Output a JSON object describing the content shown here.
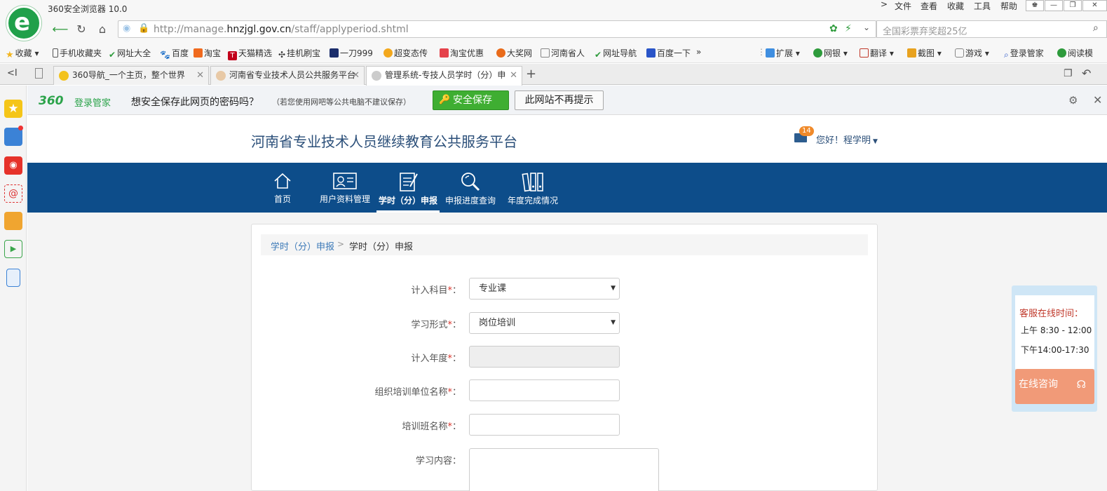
{
  "browser": {
    "title": "360安全浏览器 10.0",
    "menu": [
      "文件",
      "查看",
      "收藏",
      "工具",
      "帮助"
    ],
    "url": {
      "prefix": "http://manage.",
      "host": "hnzjgl.gov.cn",
      "path": "/staff/applyperiod.shtml"
    },
    "search_placeholder": "全国彩票弃奖超25亿",
    "favorites": [
      "收藏",
      "手机收藏夹",
      "网址大全",
      "百度",
      "淘宝",
      "天猫精选",
      "挂机刷宝",
      "一刀999",
      "超变态传",
      "淘宝优惠",
      "大奖网",
      "河南省人",
      "网址导航",
      "百度一下"
    ],
    "favorites_more": "»",
    "toolbar_right": [
      "扩展",
      "网银",
      "翻译",
      "截图",
      "游戏",
      "登录管家",
      "阅读模"
    ],
    "tabs": [
      {
        "label": "360导航_一个主页，整个世界",
        "color": "#f3c21d"
      },
      {
        "label": "河南省专业技术人员公共服务平台",
        "color": "#e8c9a6"
      },
      {
        "label": "管理系统-专技人员学时（分）申",
        "color": "#cccccc"
      }
    ],
    "new_tab": "+"
  },
  "password_bar": {
    "logo": "360",
    "brand": "登录管家",
    "question": "想安全保存此网页的密码吗？",
    "note": "（若您使用网吧等公共电脑不建议保存）",
    "save_label": "安全保存",
    "never_label": "此网站不再提示"
  },
  "site": {
    "title": "河南省专业技术人员继续教育公共服务平台",
    "mail_count": "14",
    "greeting": "您好！程学明",
    "nav": [
      {
        "label": "首页",
        "icon": "home-icon"
      },
      {
        "label": "用户资料管理",
        "icon": "profile-card-icon"
      },
      {
        "label": "学时（分）申报",
        "icon": "document-edit-icon",
        "active": true
      },
      {
        "label": "申报进度查询",
        "icon": "magnifier-icon"
      },
      {
        "label": "年度完成情况",
        "icon": "binders-icon"
      }
    ],
    "breadcrumb": {
      "link": "学时（分）申报",
      "separator": ">",
      "current": "学时（分）申报"
    },
    "form": [
      {
        "label": "计入科目",
        "required": true,
        "value": "专业课",
        "type": "select"
      },
      {
        "label": "学习形式",
        "required": true,
        "value": "岗位培训",
        "type": "select"
      },
      {
        "label": "计入年度",
        "required": true,
        "value": "",
        "type": "disabled"
      },
      {
        "label": "组织培训单位名称",
        "required": true,
        "value": "",
        "type": "text"
      },
      {
        "label": "培训班名称",
        "required": true,
        "value": "",
        "type": "text"
      },
      {
        "label": "学习内容",
        "required": false,
        "value": "",
        "type": "text"
      }
    ],
    "required_mark": "*",
    "colon": "："
  },
  "customer_service": {
    "title": "客服在线时间：",
    "am": "上午 8:30 - 12:00",
    "pm": "下午14:00-17:30",
    "button": "在线咨询"
  },
  "colors": {
    "nav_bg": "#0d4d8a",
    "title": "#2b4f79",
    "save_green": "#3fae32",
    "required_red": "#d9342b"
  }
}
